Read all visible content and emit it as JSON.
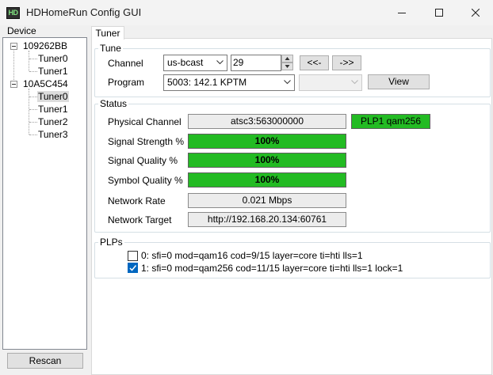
{
  "window": {
    "title": "HDHomeRun Config GUI",
    "icon_text": "HD"
  },
  "device": {
    "label": "Device",
    "tree": [
      {
        "id": "109262BB",
        "tuners": [
          "Tuner0",
          "Tuner1"
        ]
      },
      {
        "id": "10A5C454",
        "tuners": [
          "Tuner0",
          "Tuner1",
          "Tuner2",
          "Tuner3"
        ],
        "selected_tuner": "Tuner0"
      }
    ],
    "rescan_label": "Rescan"
  },
  "tabs": {
    "active": "Tuner"
  },
  "tune": {
    "group_title": "Tune",
    "channel_label": "Channel",
    "channel_map": "us-bcast",
    "channel_number": "29",
    "prev_label": "<<-",
    "next_label": "->>",
    "program_label": "Program",
    "program_value": "5003: 142.1 KPTM",
    "program2_value": "",
    "view_label": "View"
  },
  "status": {
    "group_title": "Status",
    "physical_channel_label": "Physical Channel",
    "physical_channel_value": "atsc3:563000000",
    "plp_badge": "PLP1 qam256",
    "signal_strength_label": "Signal Strength %",
    "signal_strength_value": "100%",
    "signal_strength_level": 1.0,
    "signal_quality_label": "Signal Quality %",
    "signal_quality_value": "100%",
    "signal_quality_level": 1.0,
    "symbol_quality_label": "Symbol Quality %",
    "symbol_quality_value": "100%",
    "symbol_quality_level": 1.0,
    "network_rate_label": "Network Rate",
    "network_rate_value": "0.021 Mbps",
    "network_target_label": "Network Target",
    "network_target_value": "http://192.168.20.134:60761"
  },
  "plps": {
    "group_title": "PLPs",
    "items": [
      {
        "text": "0: sfi=0 mod=qam16 cod=9/15 layer=core ti=hti lls=1",
        "checked": false
      },
      {
        "text": "1: sfi=0 mod=qam256 cod=11/15 layer=core ti=hti lls=1 lock=1",
        "checked": true
      }
    ]
  },
  "colors": {
    "status_green": "#23bb23",
    "checkbox_blue": "#0067c0",
    "selection_gray": "#dcdcdc"
  }
}
